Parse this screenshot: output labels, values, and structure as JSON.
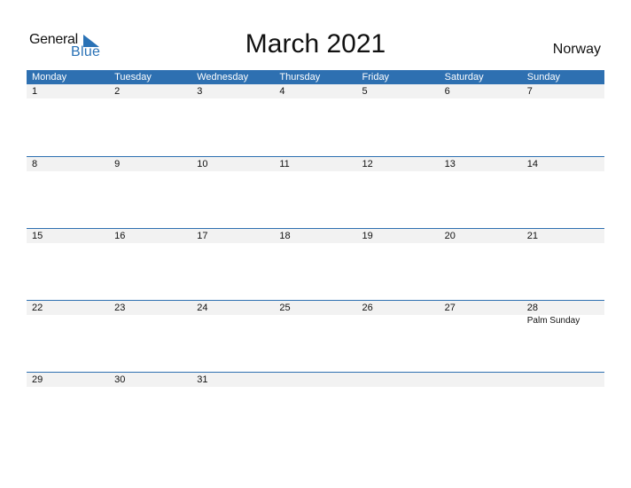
{
  "logo": {
    "line1": "General",
    "line2": "Blue"
  },
  "title": "March 2021",
  "country": "Norway",
  "colors": {
    "accent": "#2e70b1",
    "row_bg": "#f2f2f2"
  },
  "weekdays": [
    "Monday",
    "Tuesday",
    "Wednesday",
    "Thursday",
    "Friday",
    "Saturday",
    "Sunday"
  ],
  "weeks": [
    {
      "days": [
        "1",
        "2",
        "3",
        "4",
        "5",
        "6",
        "7"
      ],
      "events": [
        "",
        "",
        "",
        "",
        "",
        "",
        ""
      ]
    },
    {
      "days": [
        "8",
        "9",
        "10",
        "11",
        "12",
        "13",
        "14"
      ],
      "events": [
        "",
        "",
        "",
        "",
        "",
        "",
        ""
      ]
    },
    {
      "days": [
        "15",
        "16",
        "17",
        "18",
        "19",
        "20",
        "21"
      ],
      "events": [
        "",
        "",
        "",
        "",
        "",
        "",
        ""
      ]
    },
    {
      "days": [
        "22",
        "23",
        "24",
        "25",
        "26",
        "27",
        "28"
      ],
      "events": [
        "",
        "",
        "",
        "",
        "",
        "",
        "Palm Sunday"
      ]
    },
    {
      "days": [
        "29",
        "30",
        "31",
        "",
        "",
        "",
        ""
      ],
      "events": [
        "",
        "",
        "",
        "",
        "",
        "",
        ""
      ]
    }
  ]
}
